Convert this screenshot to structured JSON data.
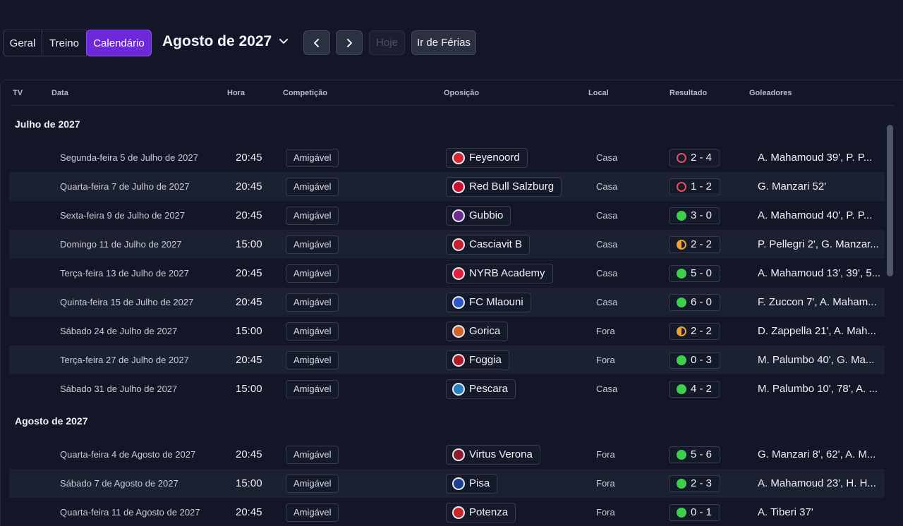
{
  "toolbar": {
    "tabs": [
      "Geral",
      "Treino",
      "Calendário"
    ],
    "active_tab": "Calendário",
    "month": "Agosto de 2027",
    "today_label": "Hoje",
    "holiday_label": "Ir de Férias"
  },
  "columns": [
    "TV",
    "Data",
    "Hora",
    "Competição",
    "Oposição",
    "Local",
    "Resultado",
    "Goleadores"
  ],
  "groups": [
    {
      "label": "Julho de 2027",
      "matches": [
        {
          "date": "Segunda-feira 5 de Julho de 2027",
          "time": "20:45",
          "comp": "Amigável",
          "opp": "Feyenoord",
          "crest": "#d8272f",
          "local": "Casa",
          "outcome": "loss",
          "score": "2 - 4",
          "scorers": "A. Mahamoud 39', P. P..."
        },
        {
          "date": "Quarta-feira 7 de Julho de 2027",
          "time": "20:45",
          "comp": "Amigável",
          "opp": "Red Bull Salzburg",
          "crest": "#c8102e",
          "local": "Casa",
          "outcome": "loss",
          "score": "1 - 2",
          "scorers": "G. Manzari 52'"
        },
        {
          "date": "Sexta-feira 9 de Julho de 2027",
          "time": "20:45",
          "comp": "Amigável",
          "opp": "Gubbio",
          "crest": "#6b2c8f",
          "local": "Casa",
          "outcome": "win",
          "score": "3 - 0",
          "scorers": "A. Mahamoud 40', P. P..."
        },
        {
          "date": "Domingo 11 de Julho de 2027",
          "time": "15:00",
          "comp": "Amigável",
          "opp": "Casciavit B",
          "crest": "#c8202a",
          "local": "Casa",
          "outcome": "draw",
          "score": "2 - 2",
          "scorers": "P. Pellegri 2', G. Manzar..."
        },
        {
          "date": "Terça-feira 13 de Julho de 2027",
          "time": "20:45",
          "comp": "Amigável",
          "opp": "NYRB Academy",
          "crest": "#e0213a",
          "local": "Casa",
          "outcome": "win",
          "score": "5 - 0",
          "scorers": "A. Mahamoud 13', 39', 5..."
        },
        {
          "date": "Quinta-feira 15 de Julho de 2027",
          "time": "20:45",
          "comp": "Amigável",
          "opp": "FC Mlaouni",
          "crest": "#2d57c7",
          "local": "Casa",
          "outcome": "win",
          "score": "6 - 0",
          "scorers": "F. Zuccon 7', A. Maham..."
        },
        {
          "date": "Sábado 24 de Julho de 2027",
          "time": "15:00",
          "comp": "Amigável",
          "opp": "Gorica",
          "crest": "#d2622a",
          "local": "Fora",
          "outcome": "draw",
          "score": "2 - 2",
          "scorers": "D. Zappella 21', A. Mah..."
        },
        {
          "date": "Terça-feira 27 de Julho de 2027",
          "time": "20:45",
          "comp": "Amigável",
          "opp": "Foggia",
          "crest": "#b01a24",
          "local": "Fora",
          "outcome": "win",
          "score": "0 - 3",
          "scorers": "M. Palumbo 40', G. Ma..."
        },
        {
          "date": "Sábado 31 de Julho de 2027",
          "time": "15:00",
          "comp": "Amigável",
          "opp": "Pescara",
          "crest": "#2a7fc0",
          "local": "Casa",
          "outcome": "win",
          "score": "4 - 2",
          "scorers": "M. Palumbo 10', 78', A. ..."
        }
      ]
    },
    {
      "label": "Agosto de 2027",
      "matches": [
        {
          "date": "Quarta-feira 4 de Agosto de 2027",
          "time": "20:45",
          "comp": "Amigável",
          "opp": "Virtus Verona",
          "crest": "#8e1b2a",
          "local": "Fora",
          "outcome": "win",
          "score": "5 - 6",
          "scorers": "G. Manzari 8', 62', A. M..."
        },
        {
          "date": "Sábado 7 de Agosto de 2027",
          "time": "15:00",
          "comp": "Amigável",
          "opp": "Pisa",
          "crest": "#1e3f8f",
          "local": "Fora",
          "outcome": "win",
          "score": "2 - 3",
          "scorers": "A. Mahamoud 23', H. H..."
        },
        {
          "date": "Quarta-feira 11 de Agosto de 2027",
          "time": "20:45",
          "comp": "Amigável",
          "opp": "Potenza",
          "crest": "#c42a2a",
          "local": "Fora",
          "outcome": "win",
          "score": "0 - 1",
          "scorers": "A. Tiberi 37'"
        }
      ]
    }
  ]
}
